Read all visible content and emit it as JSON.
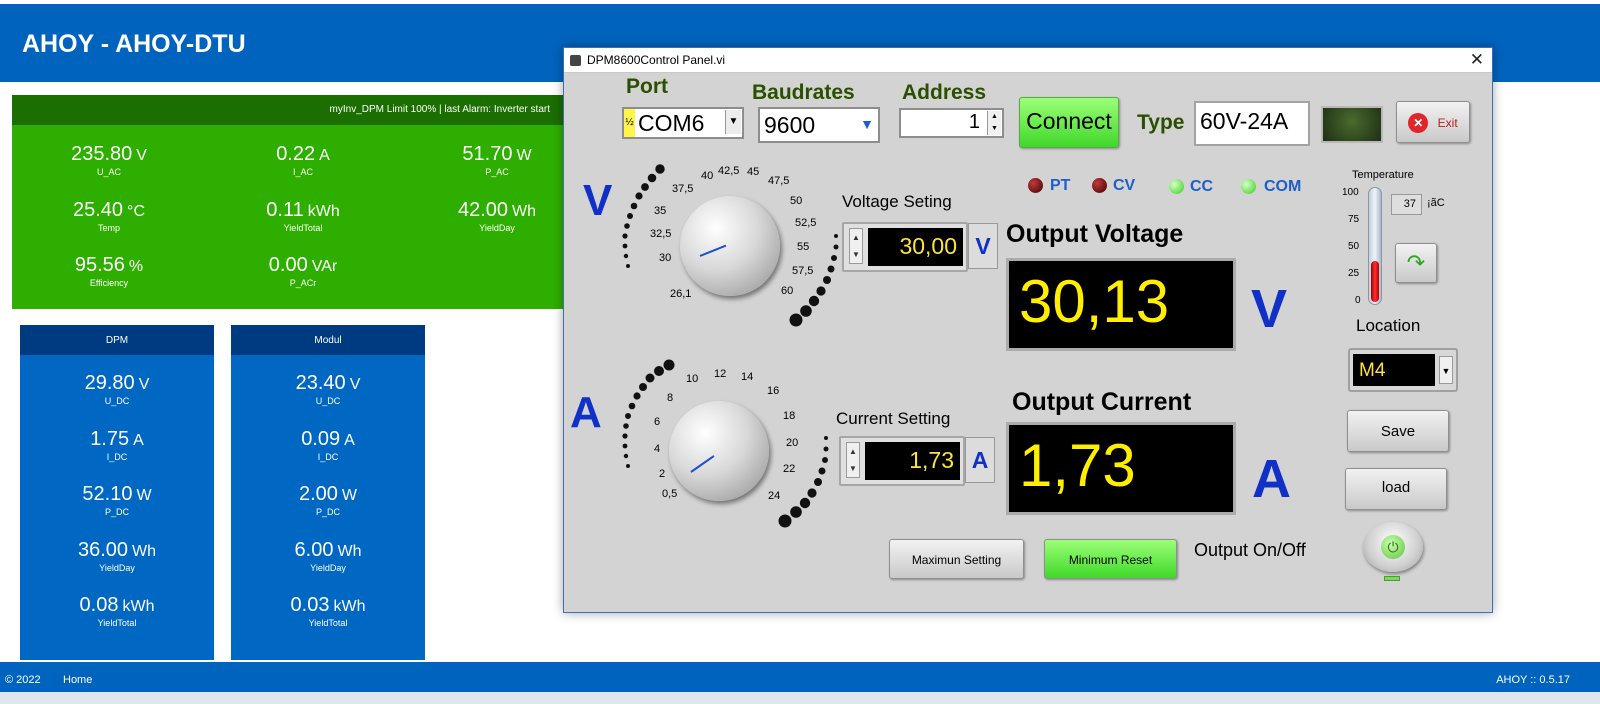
{
  "ahoy": {
    "title": "AHOY - AHOY-DTU",
    "inverter_header": "myInv_DPM Limit 100% | last Alarm: Inverter start",
    "inverter_values": [
      {
        "value": "235.80",
        "unit": "V",
        "label": "U_AC"
      },
      {
        "value": "0.22",
        "unit": "A",
        "label": "I_AC"
      },
      {
        "value": "51.70",
        "unit": "W",
        "label": "P_AC"
      },
      {
        "value": "25.40",
        "unit": "°C",
        "label": "Temp"
      },
      {
        "value": "0.11",
        "unit": "kWh",
        "label": "YieldTotal"
      },
      {
        "value": "42.00",
        "unit": "Wh",
        "label": "YieldDay"
      },
      {
        "value": "95.56",
        "unit": "%",
        "label": "Efficiency"
      },
      {
        "value": "0.00",
        "unit": "VAr",
        "label": "P_ACr"
      }
    ],
    "dpm": {
      "title": "DPM",
      "values": [
        {
          "value": "29.80",
          "unit": "V",
          "label": "U_DC"
        },
        {
          "value": "1.75",
          "unit": "A",
          "label": "I_DC"
        },
        {
          "value": "52.10",
          "unit": "W",
          "label": "P_DC"
        },
        {
          "value": "36.00",
          "unit": "Wh",
          "label": "YieldDay"
        },
        {
          "value": "0.08",
          "unit": "kWh",
          "label": "YieldTotal"
        }
      ]
    },
    "modul": {
      "title": "Modul",
      "values": [
        {
          "value": "23.40",
          "unit": "V",
          "label": "U_DC"
        },
        {
          "value": "0.09",
          "unit": "A",
          "label": "I_DC"
        },
        {
          "value": "2.00",
          "unit": "W",
          "label": "P_DC"
        },
        {
          "value": "6.00",
          "unit": "Wh",
          "label": "YieldDay"
        },
        {
          "value": "0.03",
          "unit": "kWh",
          "label": "YieldTotal"
        }
      ]
    },
    "footer": {
      "copyright": "© 2022",
      "home": "Home",
      "version": "AHOY :: 0.5.17"
    }
  },
  "panel": {
    "window_title": "DPM8600Control Panel.vi",
    "close_glyph": "✕",
    "port_label": "Port",
    "port_value": "COM6",
    "port_prefix": "½",
    "baud_label": "Baudrates",
    "baud_value": "9600",
    "address_label": "Address",
    "address_value": "1",
    "connect_label": "Connect",
    "type_label": "Type",
    "type_value": "60V-24A",
    "exit_label": "Exit",
    "exit_glyph": "✕",
    "leds": [
      {
        "label": "PT",
        "state": "red"
      },
      {
        "label": "CV",
        "state": "red"
      },
      {
        "label": "CC",
        "state": "green"
      },
      {
        "label": "COM",
        "state": "green"
      }
    ],
    "voltage_symbol": "V",
    "current_symbol": "A",
    "voltage_setting_label": "Voltage Seting",
    "voltage_setting_value": "30,00",
    "voltage_unit": "V",
    "current_setting_label": "Current Setting",
    "current_setting_value": "1,73",
    "current_unit": "A",
    "output_voltage_label": "Output Voltage",
    "output_voltage_value": "30,13",
    "output_voltage_unit": "V",
    "output_current_label": "Output Current",
    "output_current_value": "1,73",
    "output_current_unit": "A",
    "voltage_knob_ticks": [
      "26,1",
      "30",
      "32,5",
      "35",
      "37,5",
      "40",
      "42,5",
      "45",
      "47,5",
      "50",
      "52,5",
      "55",
      "57,5",
      "60"
    ],
    "current_knob_ticks": [
      "0,5",
      "2",
      "4",
      "6",
      "8",
      "10",
      "12",
      "14",
      "16",
      "18",
      "20",
      "22",
      "24"
    ],
    "temperature_label": "Temperature",
    "temperature_ticks": [
      "100",
      "75",
      "50",
      "25",
      "0"
    ],
    "temperature_value": "37",
    "temperature_unit": "¡ãC",
    "temperature_level": 0.37,
    "refresh_glyph": "↷",
    "location_label": "Location",
    "location_value": "M4",
    "save_label": "Save",
    "load_label": "load",
    "max_setting_label": "Maximun Setting",
    "min_reset_label": "Minimum Reset",
    "output_onoff_label": "Output On/Off",
    "power_glyph": "⏻",
    "spin_up": "▲",
    "spin_down": "▼",
    "drop_glyph": "▼"
  }
}
